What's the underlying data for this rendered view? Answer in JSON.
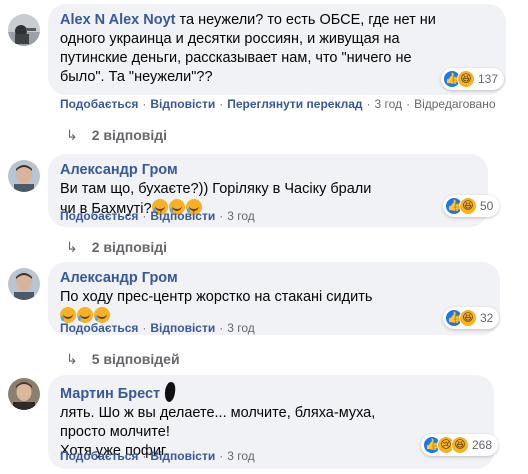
{
  "comments": [
    {
      "author": "Alex N Alex Noyt",
      "lines": [
        "та неужели? то есть ОБСЕ, где нет ни",
        "одного украинца и десятки россиян, и живущая на",
        "путинские деньги, рассказывает нам, что \"ничего не",
        "было\". Та \"неужели\"??"
      ],
      "actions": {
        "like": "Подобається",
        "reply": "Відповісти",
        "translate": "Переглянути переклад",
        "time": "3 год",
        "edited": "Відредаговано"
      },
      "reactions": {
        "count": "137",
        "types": [
          "like-icon",
          "haha-icon"
        ]
      },
      "replies": "2 відповіді"
    },
    {
      "author": "Александр Гром",
      "lines": [
        "Ви там що, бухаєте?)) Горіляку в Часіку брали",
        "чи в Бахмуті?"
      ],
      "emoji_count": 3,
      "actions": {
        "like": "Подобається",
        "reply": "Відповісти",
        "time": "3 год"
      },
      "reactions": {
        "count": "50",
        "types": [
          "like-icon",
          "haha-icon"
        ]
      },
      "replies": "2 відповіді"
    },
    {
      "author": "Александр Гром",
      "lines": [
        "По ходу прес-центр жорстко на стакані сидить"
      ],
      "emoji_count": 3,
      "actions": {
        "like": "Подобається",
        "reply": "Відповісти",
        "time": "3 год"
      },
      "reactions": {
        "count": "32",
        "types": [
          "like-icon",
          "haha-icon"
        ]
      },
      "replies": "5 відповідей"
    },
    {
      "author": "Мартин Брест",
      "line1_after_blot": "лять. Шо ж вы делаете... молчите, бляха-муха,",
      "lines": [
        "просто молчите!",
        "Хотя уже пофиг."
      ],
      "actions": {
        "like": "Подобається",
        "reply": "Відповісти",
        "time": "3 год"
      },
      "reactions": {
        "count": "268",
        "types": [
          "like-icon",
          "sad-icon",
          "haha-icon"
        ]
      }
    }
  ],
  "colors": {
    "link": "#385898",
    "bubble": "#f0f2f5",
    "meta": "#65676b",
    "like": "#1877f2",
    "haha": "#f7b125"
  }
}
